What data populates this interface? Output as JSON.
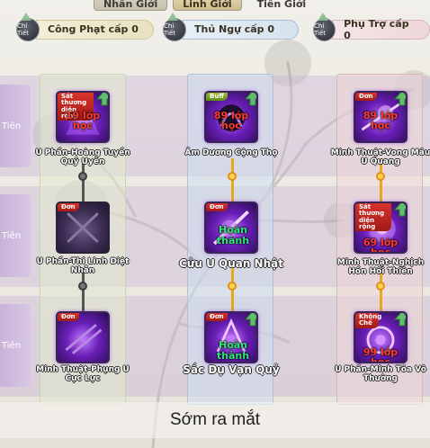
{
  "tabs": [
    "Nhân Giới",
    "Linh Giới",
    "Tiên Giới"
  ],
  "detail_label": "Chi Tiết",
  "branches": [
    "Công Phạt cấp 0",
    "Thủ Ngự cấp 0",
    "Phụ Trợ cấp 0"
  ],
  "row_labels": [
    "Tiên",
    "Tiên",
    "Tiên"
  ],
  "skills": [
    {
      "tag": "Sát thương diện rộng",
      "name": "U Phần-Hoàng Tuyền Quỷ Uyên",
      "level_line1": "19 lớp",
      "level_line2": "học",
      "status": ""
    },
    {
      "tag": "Buff",
      "name": "Âm Dương Cộng Thọ",
      "level_line1": "89 lớp",
      "level_line2": "học",
      "status": ""
    },
    {
      "tag": "Đơn",
      "name": "Minh Thuật-Vong Mâu U Quang",
      "level_line1": "89 lớp",
      "level_line2": "học",
      "status": ""
    },
    {
      "tag": "Đơn",
      "name": "U Phần-Thi Linh Diệt Nhẫn",
      "level_line1": "",
      "level_line2": "",
      "status": ""
    },
    {
      "tag": "Đơn",
      "name": "Cửu U Quan Nhật",
      "level_line1": "",
      "level_line2": "",
      "status": "Hoàn thành"
    },
    {
      "tag": "Sát thương diện rộng",
      "name": "Minh Thuật-Nghịch Hồn Hồi Thiên",
      "level_line1": "69 lớp",
      "level_line2": "học",
      "status": ""
    },
    {
      "tag": "Đơn",
      "name": "Minh Thuật-Phụng U Cực Lực",
      "level_line1": "",
      "level_line2": "",
      "status": ""
    },
    {
      "tag": "Đơn",
      "name": "Sắc Dụ Vạn Quỷ",
      "level_line1": "",
      "level_line2": "",
      "status": "Hoàn thành"
    },
    {
      "tag": "Không Chế",
      "name": "U Phần-Minh Tỏa Vô Thường",
      "level_line1": "99 lớp",
      "level_line2": "học",
      "status": ""
    }
  ],
  "footer_text": "Sớm ra mắt",
  "colors": {
    "level_red": "#ff3b2f",
    "done_green": "#2de37a",
    "gold_link": "#e8a71f",
    "grey_link": "#555555"
  }
}
